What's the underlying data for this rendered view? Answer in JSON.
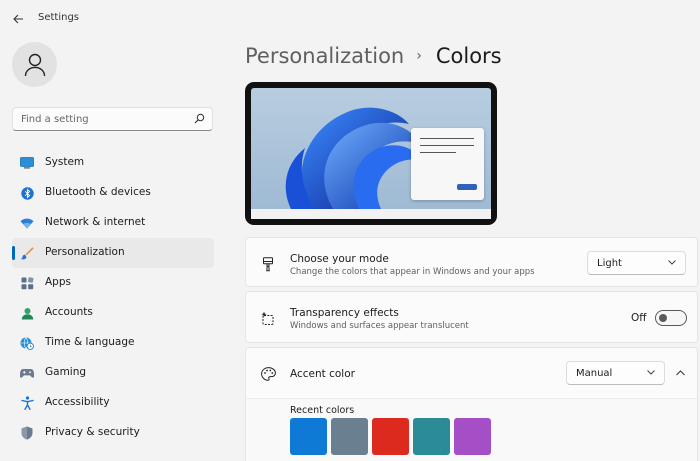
{
  "app": {
    "title": "Settings"
  },
  "sidebar": {
    "search_placeholder": "Find a setting",
    "items": [
      {
        "label": "System",
        "icon": "monitor-icon",
        "selected": false
      },
      {
        "label": "Bluetooth & devices",
        "icon": "bluetooth-icon",
        "selected": false
      },
      {
        "label": "Network & internet",
        "icon": "wifi-icon",
        "selected": false
      },
      {
        "label": "Personalization",
        "icon": "brush-icon",
        "selected": true
      },
      {
        "label": "Apps",
        "icon": "apps-icon",
        "selected": false
      },
      {
        "label": "Accounts",
        "icon": "person-icon",
        "selected": false
      },
      {
        "label": "Time & language",
        "icon": "globe-clock-icon",
        "selected": false
      },
      {
        "label": "Gaming",
        "icon": "gamepad-icon",
        "selected": false
      },
      {
        "label": "Accessibility",
        "icon": "accessibility-icon",
        "selected": false
      },
      {
        "label": "Privacy & security",
        "icon": "shield-icon",
        "selected": false
      }
    ]
  },
  "main": {
    "breadcrumb": {
      "parent": "Personalization",
      "separator": "›",
      "current": "Colors"
    },
    "mode": {
      "title": "Choose your mode",
      "subtitle": "Change the colors that appear in Windows and your apps",
      "value": "Light"
    },
    "transparency": {
      "title": "Transparency effects",
      "subtitle": "Windows and surfaces appear translucent",
      "state_label": "Off",
      "on": false
    },
    "accent": {
      "title": "Accent color",
      "value": "Manual",
      "recent_label": "Recent colors",
      "recent_colors": [
        "#0f7ad6",
        "#6a7f8f",
        "#dd2a1f",
        "#2b8c98",
        "#a54fc6"
      ]
    }
  },
  "colors": {
    "accent": "#0067c0",
    "background": "#f3f3f3",
    "card": "#fbfbfb"
  }
}
